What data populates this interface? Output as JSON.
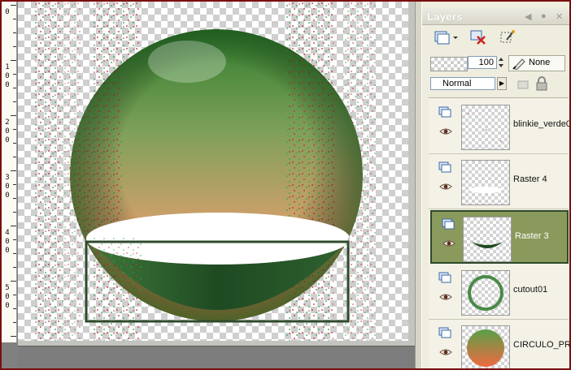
{
  "ruler": {
    "labels": [
      {
        "digits": [
          "0"
        ]
      },
      {
        "digits": [
          "1",
          "0",
          "0"
        ]
      },
      {
        "digits": [
          "2",
          "0",
          "0"
        ]
      },
      {
        "digits": [
          "3",
          "0",
          "0"
        ]
      },
      {
        "digits": [
          "4",
          "0",
          "0"
        ]
      },
      {
        "digits": [
          "5",
          "0",
          "0"
        ]
      }
    ]
  },
  "layers_palette": {
    "title": "Layers",
    "opacity_value": "100",
    "blend_chip_label": "None",
    "blend_mode": "Normal",
    "layers": [
      {
        "name": "blinkie_verde0",
        "selected": false
      },
      {
        "name": "Raster 4",
        "selected": false
      },
      {
        "name": "Raster 3",
        "selected": true
      },
      {
        "name": "cutout01",
        "selected": false
      },
      {
        "name": "CIRCULO_PR",
        "selected": false
      }
    ]
  },
  "colors": {
    "sphere_top": "#2d7a2a",
    "sphere_bottom": "#e07a4a",
    "bowl_dark": "#1e4a22",
    "selection_frame": "#2f4a2c"
  }
}
